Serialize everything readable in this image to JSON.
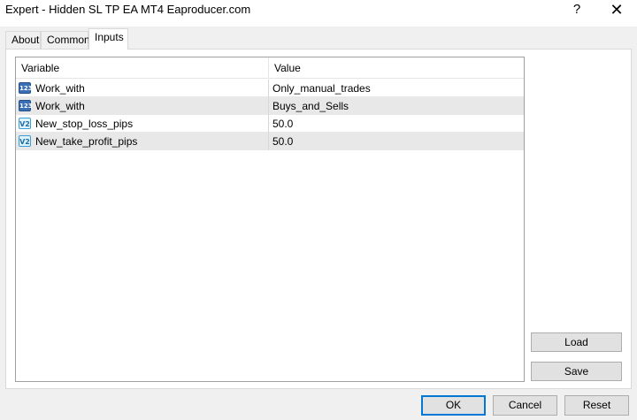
{
  "window": {
    "title": "Expert - Hidden SL TP EA MT4 Eaproducer.com",
    "help_glyph": "?",
    "close_glyph": "✕"
  },
  "tabs": [
    {
      "label": "About"
    },
    {
      "label": "Common"
    },
    {
      "label": "Inputs"
    }
  ],
  "table": {
    "columns": [
      "Variable",
      "Value"
    ],
    "rows": [
      {
        "variable": "Work_with",
        "value": "Only_manual_trades",
        "icon": "int-icon"
      },
      {
        "variable": "Work_with",
        "value": "Buys_and_Sells",
        "icon": "int-icon"
      },
      {
        "variable": "New_stop_loss_pips",
        "value": "50.0",
        "icon": "double-icon"
      },
      {
        "variable": "New_take_profit_pips",
        "value": "50.0",
        "icon": "double-icon"
      }
    ]
  },
  "side_buttons": {
    "load": "Load",
    "save": "Save"
  },
  "footer": {
    "ok": "OK",
    "cancel": "Cancel",
    "reset": "Reset"
  },
  "colors": {
    "accent": "#0078d7",
    "selected_row": "#e8e8e8"
  }
}
